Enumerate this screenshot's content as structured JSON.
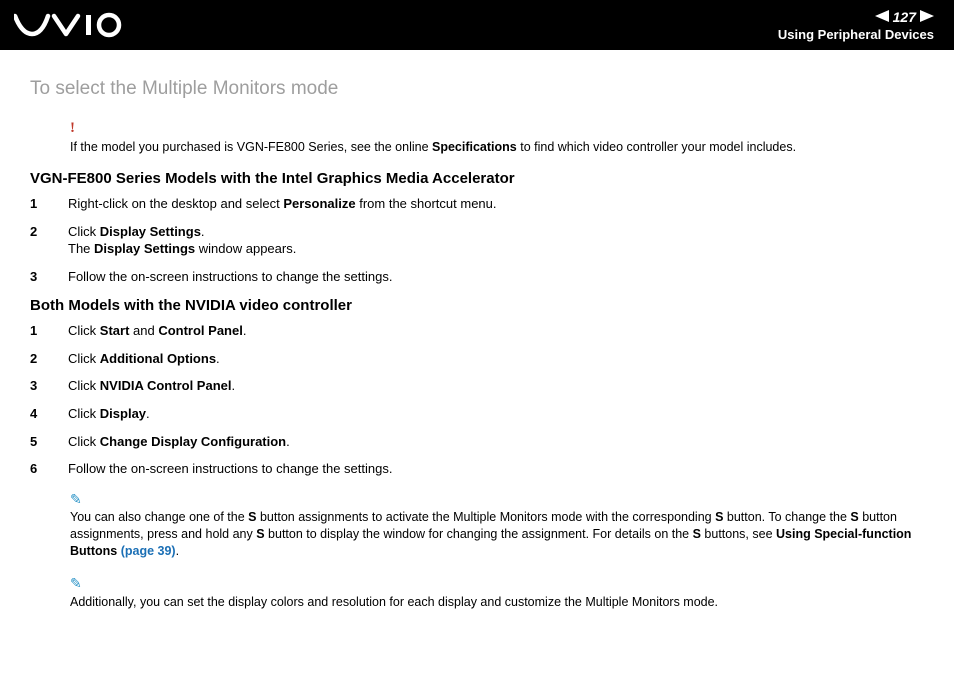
{
  "header": {
    "page_number": "127",
    "section": "Using Peripheral Devices"
  },
  "title": "To select the Multiple Monitors mode",
  "warning": {
    "icon": "!",
    "text_before": "If the model you purchased is VGN-FE800 Series, see the online ",
    "bold1": "Specifications",
    "text_after": " to find which video controller your model includes."
  },
  "sectionA": {
    "heading": "VGN-FE800 Series Models with the Intel Graphics Media Accelerator",
    "steps": [
      {
        "n": "1",
        "pre": "Right-click on the desktop and select ",
        "b": "Personalize",
        "post": " from the shortcut menu."
      },
      {
        "n": "2",
        "pre": "Click ",
        "b": "Display Settings",
        "post": ".",
        "line2_pre": "The ",
        "line2_b": "Display Settings",
        "line2_post": " window appears."
      },
      {
        "n": "3",
        "pre": "Follow the on-screen instructions to change the settings.",
        "b": "",
        "post": ""
      }
    ]
  },
  "sectionB": {
    "heading": "Both Models with the NVIDIA video controller",
    "steps": [
      {
        "n": "1",
        "pre": "Click ",
        "b": "Start",
        "mid": " and ",
        "b2": "Control Panel",
        "post": "."
      },
      {
        "n": "2",
        "pre": "Click ",
        "b": "Additional Options",
        "post": "."
      },
      {
        "n": "3",
        "pre": "Click ",
        "b": "NVIDIA Control Panel",
        "post": "."
      },
      {
        "n": "4",
        "pre": "Click ",
        "b": "Display",
        "post": "."
      },
      {
        "n": "5",
        "pre": "Click ",
        "b": "Change Display Configuration",
        "post": "."
      },
      {
        "n": "6",
        "pre": "Follow the on-screen instructions to change the settings.",
        "b": "",
        "post": ""
      }
    ]
  },
  "tip1": {
    "t1": "You can also change one of the ",
    "b1": "S",
    "t2": " button assignments to activate the Multiple Monitors mode with the corresponding ",
    "b2": "S",
    "t3": " button. To change the ",
    "b3": "S",
    "t4": " button assignments, press and hold any ",
    "b4": "S",
    "t5": " button to display the window for changing the assignment. For details on the ",
    "b5": "S",
    "t6": " buttons, see ",
    "b6": "Using Special-function Buttons ",
    "link": "(page 39)",
    "t7": "."
  },
  "tip2": "Additionally, you can set the display colors and resolution for each display and customize the Multiple Monitors mode."
}
